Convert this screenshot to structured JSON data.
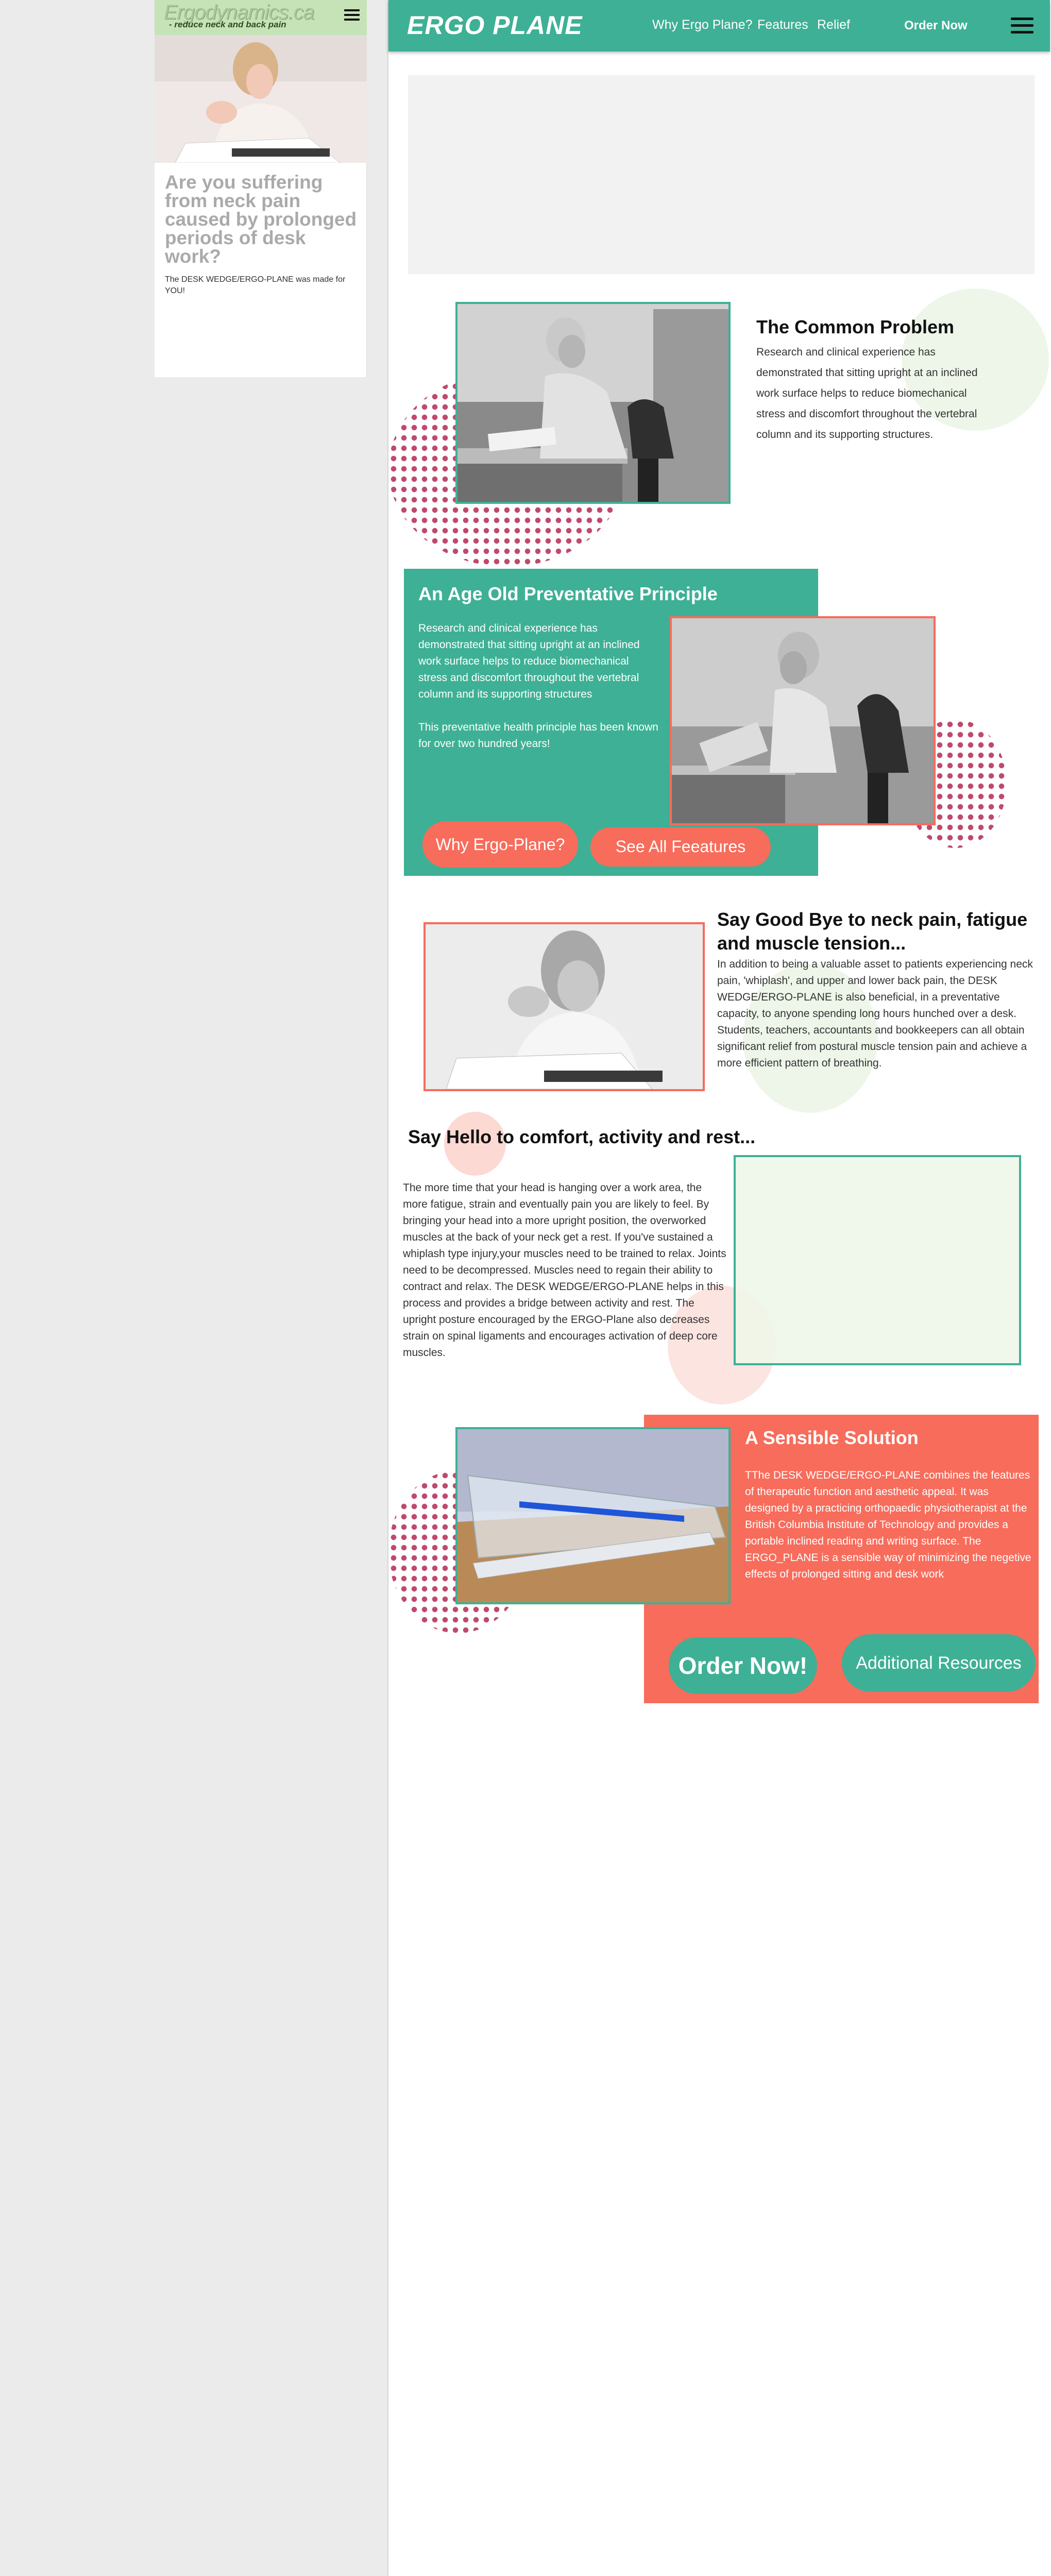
{
  "mobile": {
    "logo": "Ergodynamics.ca",
    "tagline": "- reduce neck and back pain",
    "headline": "Are you suffering from neck pain caused by prolonged periods of desk work?",
    "body": "The DESK WEDGE/ERGO-PLANE was made for YOU!"
  },
  "nav": {
    "brand": "ERGO PLANE",
    "links": [
      "Why Ergo Plane?",
      "Features",
      "Relief"
    ],
    "order": "Order Now"
  },
  "sections": {
    "common_problem": {
      "title": "The Common Problem",
      "body": "Research and clinical experience has demonstrated that sitting upright at an inclined work surface helps to reduce biomechanical stress and discomfort throughout the vertebral column and its supporting structures."
    },
    "age_old": {
      "title": "An Age Old Preventative Principle",
      "body1": "Research and clinical experience has demonstrated that sitting upright at an inclined work surface helps to reduce biomechanical stress and discomfort throughout the vertebral column and its supporting structures",
      "body2": "This preventative health principle has been known for over two hundred years!",
      "btn_why": "Why Ergo-Plane?",
      "btn_features": "See All Feeatures"
    },
    "goodbye": {
      "title": "Say Good Bye to neck pain, fatigue and muscle tension...",
      "body": "In addition to being a valuable asset to patients experiencing neck pain, 'whiplash', and upper and lower back pain, the DESK WEDGE/ERGO-PLANE is also beneficial, in a preventative capacity, to anyone spending long hours hunched over a desk.  Students, teachers, accountants and bookkeepers can all obtain significant relief from postural muscle tension pain and achieve a more efficient pattern of breathing."
    },
    "hello": {
      "title": "Say Hello to comfort, activity and rest...",
      "body": "The more time that your head is hanging over a work area, the more fatigue, strain and eventually pain you are likely to feel.  By bringing your head into a more upright position, the overworked muscles at the back  of your neck get a rest. If you've sustained a whiplash type injury,your muscles need to be trained to relax.  Joints need to be decompressed.  Muscles need to regain their ability to contract and relax. The DESK WEDGE/ERGO-PLANE helps in this process and provides a bridge between activity and rest. The upright posture encouraged by the ERGO-Plane also decreases strain on spinal ligaments and encourages activation of deep core muscles."
    },
    "sensible": {
      "title": "A Sensible Solution",
      "body": "TThe DESK WEDGE/ERGO-PLANE combines the features of therapeutic function and aesthetic appeal.  It was designed by a practicing orthopaedic physiotherapist at the British Columbia Institute of Technology and provides a portable inclined reading and writing surface. The ERGO_PLANE is a sensible way of minimizing the negetive effects of prolonged sitting and desk work",
      "btn_order": "Order Now!",
      "btn_resources": "Additional Resources"
    }
  },
  "colors": {
    "teal": "#3eb095",
    "coral": "#f76c5b",
    "light_green": "#c6e3b7",
    "dots": "#b52a54"
  },
  "icons": [
    "hamburger-menu-icon"
  ]
}
